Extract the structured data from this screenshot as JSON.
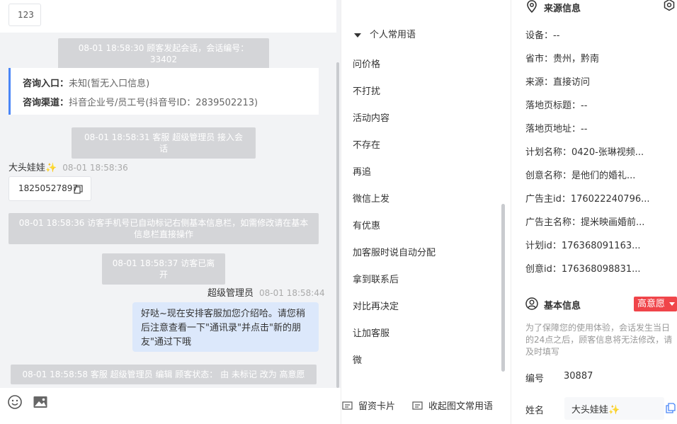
{
  "chat": {
    "top_snippet": "123",
    "sys_session_start": "08-01 18:58:30 顾客发起会话，会话编号：33402",
    "entry": {
      "label1": "咨询入口：",
      "value1": "未知(暂无入口信息)",
      "label2": "咨询渠道：",
      "value2": "抖音企业号/员工号(抖音号ID：2839502213)"
    },
    "sys_agent_join": "08-01 18:58:31 客服 超级管理员 接入会话",
    "visitor_name": "大头娃娃",
    "visitor_emoji": "✨",
    "visitor_time": "08-01 18:58:36",
    "visitor_msg": "18250527897",
    "sys_auto_mark": "08-01 18:58:36 访客手机号已自动标记右侧基本信息栏，如需修改请在基本信息栏直接操作",
    "sys_left": "08-01 18:58:37 访客已离开",
    "agent_name": "超级管理员",
    "agent_time": "08-01 18:58:44",
    "agent_msg": "好哒~现在安排客服加您介绍哈。请您稍后注意查看一下\"通讯录\"并点击\"新的朋友\"通过下哦",
    "sys_edit": "08-01 18:58:58 客服 超级管理员 编辑 顾客状态： 由 未标记 改为 高意愿"
  },
  "phrases": {
    "group_title": "个人常用语",
    "items": [
      "问价格",
      "不打扰",
      "活动内容",
      "不存在",
      "再追",
      "微信上发",
      "有优惠",
      "加客服时说自动分配",
      "拿到联系后",
      "对比再决定",
      "让加客服",
      "微"
    ],
    "btn_card": "留资卡片",
    "btn_collapse": "收起图文常用语"
  },
  "info": {
    "source_title": "来源信息",
    "rows": [
      "设备：--",
      "省市：贵州，黔南",
      "来源：直接访问",
      "落地页标题：--",
      "落地页地址：--",
      "计划名称：0420-张琳视频...",
      "创意名称：是他们的婚礼...",
      "广告主id：176022240796...",
      "广告主名称：提米映画婚前...",
      "计划id：176368091163...",
      "创意id：176368098831..."
    ],
    "basic_title": "基本信息",
    "intent_badge": "高意愿",
    "hint": "为了保障您的使用体验，会话发生当日的24点之后，顾客信息将无法修改，请及时填写",
    "id_label": "编号",
    "id_value": "30887",
    "name_label": "姓名",
    "name_value": "大头娃娃",
    "name_emoji": "✨"
  },
  "colors": {
    "accent_blue": "#4a86f7",
    "badge_red": "#f0454a",
    "bubble_blue": "#dce8fb",
    "sys_gray": "#d4d5d8"
  }
}
